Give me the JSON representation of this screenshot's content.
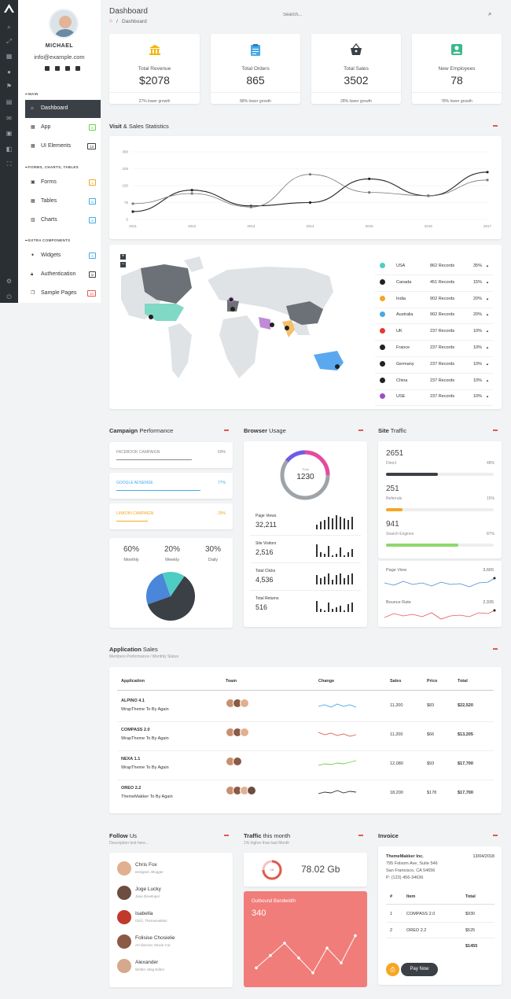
{
  "user": {
    "name": "MICHAEL",
    "email": "info@example.com"
  },
  "sidebar": {
    "sections": [
      "MAIN",
      "FORMS, CHARTS, TABLES",
      "EXTRA COMPONENTS"
    ],
    "items": [
      {
        "label": "Dashboard",
        "badge": ""
      },
      {
        "label": "App",
        "badge": "5"
      },
      {
        "label": "UI Elements",
        "badge": "13"
      },
      {
        "label": "Forms",
        "badge": "4"
      },
      {
        "label": "Tables",
        "badge": "6"
      },
      {
        "label": "Charts",
        "badge": "6"
      },
      {
        "label": "Widgets",
        "badge": "4"
      },
      {
        "label": "Authentication",
        "badge": "8"
      },
      {
        "label": "Sample Pages",
        "badge": "10"
      }
    ]
  },
  "header": {
    "title": "Dashboard",
    "breadcrumb": "Dashboard",
    "search_placeholder": "Search..."
  },
  "stats": [
    {
      "label": "Total Revenue",
      "value": "$2078",
      "growth": "27% lower growth",
      "color": "#f5b400"
    },
    {
      "label": "Total Orders",
      "value": "865",
      "growth": "88% lower growth",
      "color": "#45a9e6"
    },
    {
      "label": "Total Sales",
      "value": "3502",
      "growth": "28% lower growth",
      "color": "#3a4046"
    },
    {
      "label": "New Employees",
      "value": "78",
      "growth": "78% lower growth",
      "color": "#3bb88a"
    }
  ],
  "visit": {
    "title_bold": "Visit",
    "title_rest": " & Sales Statistics",
    "chart_data": {
      "type": "line",
      "x": [
        "2011",
        "2012",
        "2013",
        "2014",
        "2015",
        "2016",
        "2017"
      ],
      "yticks": [
        "0",
        "75",
        "150",
        "225",
        "300"
      ],
      "ylim": [
        0,
        300
      ],
      "series": [
        {
          "values": [
            35,
            130,
            60,
            75,
            180,
            105,
            210
          ],
          "color": "#222"
        },
        {
          "values": [
            70,
            115,
            55,
            200,
            120,
            105,
            175
          ],
          "color": "#777"
        }
      ]
    }
  },
  "map_list": [
    {
      "country": "USA",
      "records": "862 Records",
      "pct": "35%",
      "color": "#4ecdc4"
    },
    {
      "country": "Canada",
      "records": "451 Records",
      "pct": "15%",
      "color": "#222"
    },
    {
      "country": "India",
      "records": "902 Records",
      "pct": "20%",
      "color": "#f5a623"
    },
    {
      "country": "Australia",
      "records": "902 Records",
      "pct": "20%",
      "color": "#45a9e6"
    },
    {
      "country": "UK",
      "records": "237 Records",
      "pct": "10%",
      "color": "#e53935"
    },
    {
      "country": "France",
      "records": "237 Records",
      "pct": "10%",
      "color": "#222"
    },
    {
      "country": "Germany",
      "records": "237 Records",
      "pct": "10%",
      "color": "#222"
    },
    {
      "country": "China",
      "records": "237 Records",
      "pct": "10%",
      "color": "#222"
    },
    {
      "country": "USE",
      "records": "237 Records",
      "pct": "10%",
      "color": "#9b4fc1"
    }
  ],
  "campaign": {
    "title_bold": "Campaign",
    "title_rest": " Performance",
    "items": [
      {
        "label": "FACEBOOK CAMPAIGN",
        "pct": "69%",
        "value": 0.69,
        "color": "#888"
      },
      {
        "label": "GOOGLE ADSENSE",
        "pct": "77%",
        "value": 0.77,
        "color": "#45a9e6"
      },
      {
        "label": "LINKDIN CAMPAIGN",
        "pct": "29%",
        "value": 0.29,
        "color": "#f5a623"
      }
    ],
    "pie_stats": [
      {
        "value": "60%",
        "label": "Monthly"
      },
      {
        "value": "20%",
        "label": "Weekly"
      },
      {
        "value": "30%",
        "label": "Daily"
      }
    ],
    "pie": [
      {
        "value": 0.6,
        "color": "#3a4046"
      },
      {
        "value": 0.25,
        "color": "#4a86d9"
      },
      {
        "value": 0.15,
        "color": "#4ecdc4"
      }
    ]
  },
  "browser": {
    "title_bold": "Browser",
    "title_rest": " Usage",
    "donut_label": "Total",
    "donut_value": "1230",
    "rows": [
      {
        "label": "Page Views",
        "value": "32,211"
      },
      {
        "label": "Site Visitors",
        "value": "2,516"
      },
      {
        "label": "Total Clicks",
        "value": "4,536"
      },
      {
        "label": "Total Returns",
        "value": "516"
      }
    ]
  },
  "site_traffic": {
    "title_bold": "Site",
    "title_rest": " Traffic",
    "items": [
      {
        "value": "2651",
        "label": "Direct",
        "pct": "48%",
        "fill": 0.48,
        "color": "#3a4046"
      },
      {
        "value": "251",
        "label": "Referrals",
        "pct": "15%",
        "fill": 0.15,
        "color": "#f5a623"
      },
      {
        "value": "941",
        "label": "Search Engines",
        "pct": "87%",
        "fill": 0.67,
        "color": "#8dd86d"
      }
    ],
    "page_view_label": "Page View",
    "page_view_value": "3,665",
    "bounce_label": "Bounce Rate",
    "bounce_value": "2,935"
  },
  "app_sales": {
    "title_bold": "Application",
    "title_rest": " Sales",
    "subtitle": "Members Preformance / Monthly Status",
    "headers": [
      "Application",
      "Team",
      "Change",
      "Sales",
      "Price",
      "Total"
    ],
    "rows": [
      {
        "app": "ALPINO 4.1",
        "by": "WrapTheme To By Again",
        "faces": 3,
        "color": "#45a9e6",
        "sales": "11,200",
        "price": "$83",
        "total": "$22,520"
      },
      {
        "app": "COMPASS 2.0",
        "by": "WrapTheme To By Again",
        "faces": 3,
        "color": "#e05a4e",
        "sales": "11,200",
        "price": "$66",
        "total": "$13,205"
      },
      {
        "app": "NEXA 1.1",
        "by": "WrapTheme To By Again",
        "faces": 2,
        "color": "#6cd04a",
        "sales": "12,080",
        "price": "$93",
        "total": "$17,700"
      },
      {
        "app": "OREO 2.2",
        "by": "ThemeMakker To By Again",
        "faces": 4,
        "color": "#333",
        "sales": "18,200",
        "price": "$178",
        "total": "$17,700"
      }
    ]
  },
  "follow": {
    "title_bold": "Follow",
    "title_rest": " Us",
    "subtitle": "Description text here...",
    "people": [
      {
        "name": "Chris Fox",
        "role": "Designer, Blogger"
      },
      {
        "name": "Joge Lucky",
        "role": "Java Developer"
      },
      {
        "name": "Isabella",
        "role": "CEO, Thememakker"
      },
      {
        "name": "Folisise Chosielie",
        "role": "Art director, Movie Cut"
      },
      {
        "name": "Alexander",
        "role": "Writter, Mag Editor"
      }
    ]
  },
  "traffic_month": {
    "title_bold": "Traffic",
    "title_rest": " this month",
    "subtitle": "1% higher than last Month",
    "value": "78.02 Gb",
    "ring_label": "18",
    "bw_label": "Outbound Bandwidth",
    "bw_value": "340",
    "bw_points": [
      20,
      45,
      70,
      40,
      10,
      60,
      30,
      85
    ]
  },
  "invoice": {
    "title_bold": "Invoice",
    "company": "ThemeMakker Inc.",
    "address": [
      "795 Folsom Ave, Suite 546",
      "San Francisco, CA 54656",
      "P: (123) 456-34636"
    ],
    "date": "13/04/2018",
    "headers": [
      "#",
      "Item",
      "Total"
    ],
    "rows": [
      {
        "n": "1",
        "item": "COMPASS 2.0",
        "total": "$930"
      },
      {
        "n": "2",
        "item": "OREO 2.2",
        "total": "$525"
      }
    ],
    "grand_total": "$1455",
    "pay_label": "Pay Now"
  },
  "colors": {
    "accent": "#e05a4e",
    "dark": "#3a4046",
    "bandwidth": "#f07d7a"
  }
}
